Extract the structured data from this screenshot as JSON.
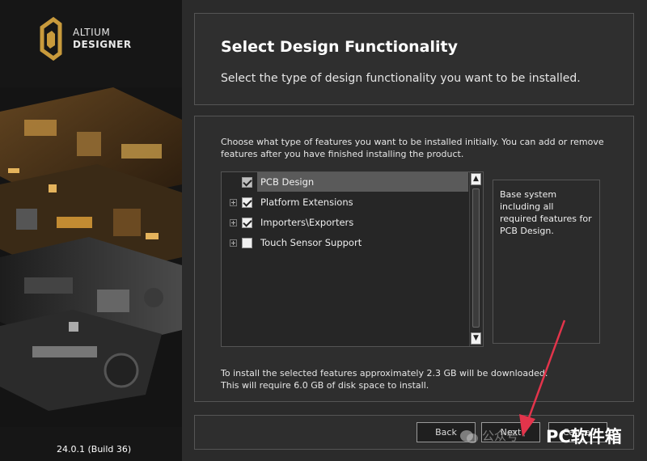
{
  "brand": {
    "line1": "ALTIUM",
    "line2": "DESIGNER",
    "version": "24.0.1 (Build 36)"
  },
  "header": {
    "title": "Select Design Functionality",
    "subtitle": "Select the type of design functionality you want to be installed."
  },
  "content": {
    "description": "Choose what type of features you want to be installed initially. You can add or remove features after you have finished installing the product.",
    "features": [
      {
        "label": "PCB Design",
        "checked": true,
        "expandable": false,
        "selected": true,
        "disabled": true
      },
      {
        "label": "Platform Extensions",
        "checked": true,
        "expandable": true
      },
      {
        "label": "Importers\\Exporters",
        "checked": true,
        "expandable": true
      },
      {
        "label": "Touch Sensor Support",
        "checked": false,
        "expandable": true
      }
    ],
    "feature_info": "Base system including all required features for PCB Design.",
    "download_line1": "To install the selected features approximately 2.3 GB will be downloaded.",
    "download_line2": "This will require 6.0 GB of disk space to install."
  },
  "footer": {
    "back": "Back",
    "next": "Next",
    "cancel": "Cancel"
  },
  "watermark": {
    "left": "公众号 · ",
    "right": "PC软件箱"
  },
  "colors": {
    "accent": "#c89a3c",
    "arrow": "#e3344b"
  }
}
